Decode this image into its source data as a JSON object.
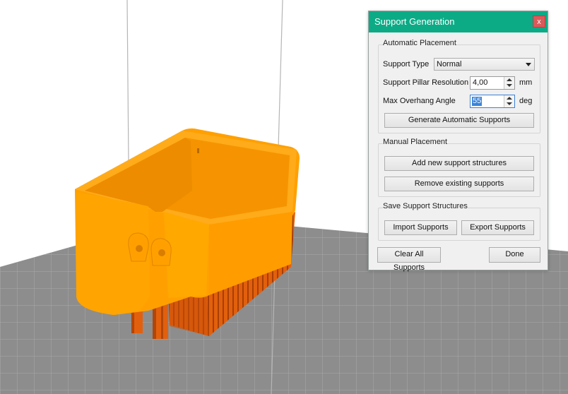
{
  "dialog": {
    "title": "Support Generation",
    "close_label": "x",
    "automatic": {
      "title": "Automatic Placement",
      "support_type_label": "Support Type",
      "support_type_value": "Normal",
      "pillar_label": "Support Pillar Resolution",
      "pillar_value": "4,00",
      "pillar_unit": "mm",
      "angle_label": "Max Overhang Angle",
      "angle_value": "55",
      "angle_unit": "deg",
      "generate_label": "Generate Automatic Supports"
    },
    "manual": {
      "title": "Manual Placement",
      "add_label": "Add new support structures",
      "remove_label": "Remove existing supports"
    },
    "save": {
      "title": "Save Support Structures",
      "import_label": "Import Supports",
      "export_label": "Export Supports"
    },
    "clear_label": "Clear All Supports",
    "done_label": "Done"
  },
  "colors": {
    "titlebar": "#0cab86",
    "model": "#ffa000",
    "supports": "#e25b0a",
    "build_plate": "#8e8e8e"
  }
}
